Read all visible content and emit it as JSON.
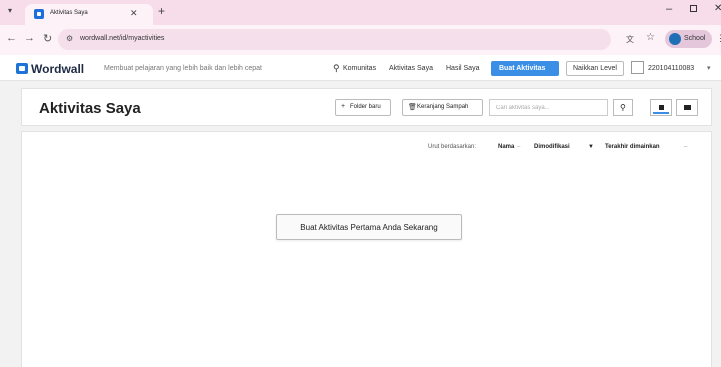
{
  "browser": {
    "tab_title": "Aktivitas Saya",
    "url": "wordwall.net/id/myactivities",
    "profile_label": "School",
    "profile_initial": "S"
  },
  "header": {
    "logo": "Wordwall",
    "tagline": "Membuat pelajaran yang lebih baik dan lebih cepat",
    "nav": {
      "community": "Komunitas",
      "my_activities": "Aktivitas Saya",
      "my_results": "Hasil Saya"
    },
    "create_button": "Buat Aktivitas",
    "upgrade_button": "Naikkan Level",
    "username": "220104110083"
  },
  "toolbar": {
    "title": "Aktivitas Saya",
    "new_folder": "Folder baru",
    "trash": "Keranjang Sampah",
    "search_placeholder": "Cari aktivitas saya..."
  },
  "sort": {
    "label": "Urut berdasarkan:",
    "options": [
      "Nama",
      "Dimodifikasi",
      "Terakhir dimainkan"
    ]
  },
  "empty_state": {
    "button": "Buat Aktivitas Pertama Anda Sekarang"
  },
  "colors": {
    "tab_strip": "#f7dcea",
    "accent": "#3a8ee6",
    "brand": "#1e74d6"
  }
}
